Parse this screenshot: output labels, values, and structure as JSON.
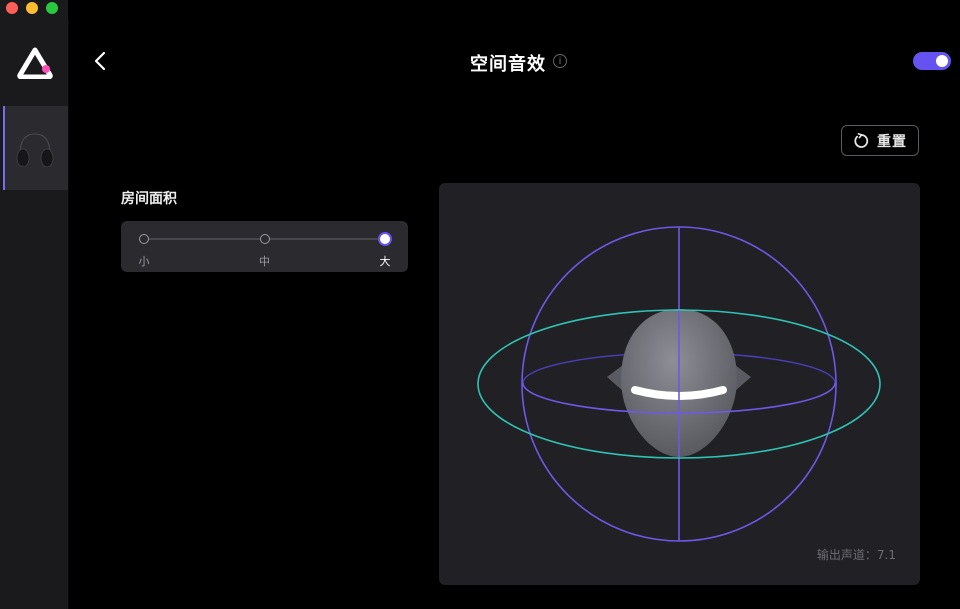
{
  "header": {
    "title": "空间音效",
    "info_glyph": "i",
    "spatial_audio_enabled": true
  },
  "reset": {
    "label": "重置"
  },
  "room_area": {
    "label": "房间面积",
    "options": [
      "小",
      "中",
      "大"
    ],
    "selected_index": 2
  },
  "output": {
    "label": "输出声道：",
    "value": "7.1"
  },
  "colors": {
    "accent": "#6552f0",
    "sphere": "#6f58e6",
    "orbit": "#2fc3b3",
    "panel": "#202025",
    "sidebar": "#1a1a1d"
  },
  "icons": {
    "back": "chevron-left-icon",
    "info": "info-icon",
    "reset": "refresh-icon",
    "logo": "app-logo-icon",
    "device": "headset-icon"
  }
}
